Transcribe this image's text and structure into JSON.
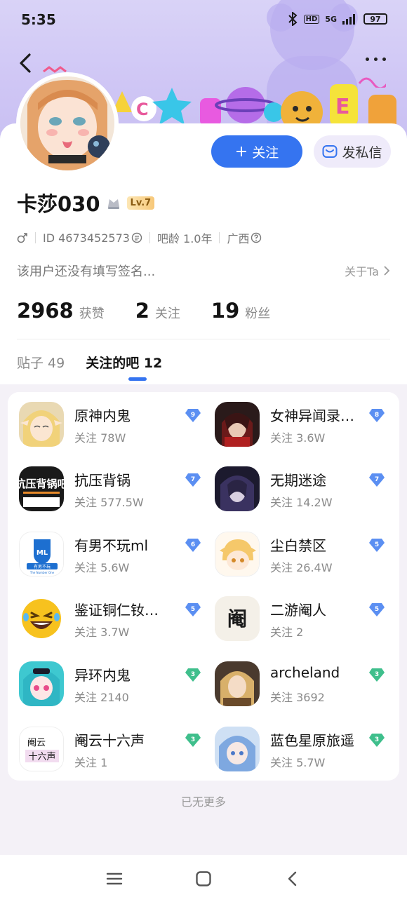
{
  "status_bar": {
    "time": "5:35",
    "network": "5G",
    "hd": "HD",
    "battery": "97"
  },
  "profile": {
    "username": "卡莎030",
    "level": "Lv.7",
    "gender_icon": "male-icon",
    "id_text": "ID 4673452573",
    "tieba_age": "吧龄 1.0年",
    "location": "广西",
    "signature": "该用户还没有填写签名...",
    "about_label": "关于Ta"
  },
  "actions": {
    "follow_label": "关注",
    "follow_plus": "+",
    "dm_label": "发私信"
  },
  "stats": [
    {
      "value": "2968",
      "label": "获赞"
    },
    {
      "value": "2",
      "label": "关注"
    },
    {
      "value": "19",
      "label": "粉丝"
    }
  ],
  "tabs": [
    {
      "label": "贴子 49",
      "active": false
    },
    {
      "label": "关注的吧 12",
      "active": true
    }
  ],
  "bars": [
    {
      "name": "原神内鬼",
      "followers": "关注 78W",
      "level": "9",
      "badge_color": "#5b8ff2"
    },
    {
      "name": "女神异闻录…",
      "followers": "关注 3.6W",
      "level": "8",
      "badge_color": "#5b8ff2"
    },
    {
      "name": "抗压背锅",
      "followers": "关注 577.5W",
      "level": "7",
      "badge_color": "#5b8ff2"
    },
    {
      "name": "无期迷途",
      "followers": "关注 14.2W",
      "level": "7",
      "badge_color": "#5b8ff2"
    },
    {
      "name": "有男不玩ml",
      "followers": "关注 5.6W",
      "level": "6",
      "badge_color": "#5b8ff2"
    },
    {
      "name": "尘白禁区",
      "followers": "关注 26.4W",
      "level": "5",
      "badge_color": "#5b8ff2"
    },
    {
      "name": "鉴证铜仁钕…",
      "followers": "关注 3.7W",
      "level": "5",
      "badge_color": "#5b8ff2"
    },
    {
      "name": "二游阉人",
      "followers": "关注 2",
      "level": "5",
      "badge_color": "#5b8ff2"
    },
    {
      "name": "异环内鬼",
      "followers": "关注 2140",
      "level": "3",
      "badge_color": "#3fbf8c"
    },
    {
      "name": "archeland",
      "followers": "关注 3692",
      "level": "3",
      "badge_color": "#3fbf8c"
    },
    {
      "name": "阉云十六声",
      "followers": "关注 1",
      "level": "3",
      "badge_color": "#3fbf8c"
    },
    {
      "name": "蓝色星原旅遥",
      "followers": "关注 5.7W",
      "level": "3",
      "badge_color": "#3fbf8c"
    }
  ],
  "bar_icon_text": {
    "kangya": "抗压背锅吧",
    "ml_top": "ML",
    "ml_bottom": "有男不玩",
    "ml_sub": "The Number One",
    "yanren": "阉",
    "yanyun_top": "阉云",
    "yanyun_bottom": "十六声"
  },
  "footer": {
    "no_more": "已无更多"
  },
  "colors": {
    "accent": "#3574f0",
    "banner": "#d9d3f7",
    "dm_button_bg": "#efebfa"
  }
}
